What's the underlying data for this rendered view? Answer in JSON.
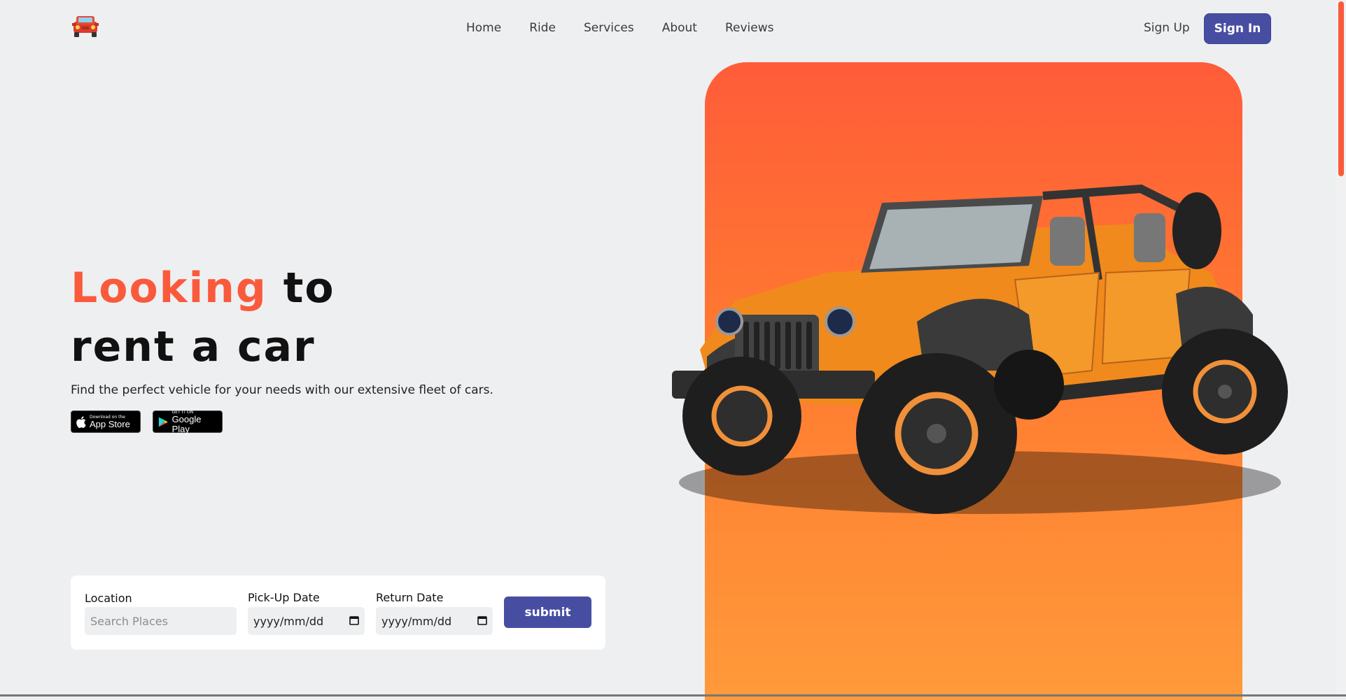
{
  "nav": {
    "logo_icon": "red-car-icon",
    "links": [
      "Home",
      "Ride",
      "Services",
      "About",
      "Reviews"
    ],
    "signup": "Sign Up",
    "signin": "Sign In"
  },
  "hero": {
    "title_accent": "Looking",
    "title_rest1": " to",
    "title_line2": "rent a car",
    "subtitle": "Find the perfect vehicle for your needs with our extensive fleet of cars.",
    "appstore_small": "Download on the",
    "appstore_big": "App Store",
    "googleplay_small": "GET IT ON",
    "googleplay_big": "Google Play",
    "image": "orange-jeep-image"
  },
  "form": {
    "location_label": "Location",
    "location_placeholder": "Search Places",
    "pickup_label": "Pick-Up Date",
    "pickup_value": "yyyy/mm/dd",
    "return_label": "Return Date",
    "return_value": "yyyy/mm/dd",
    "submit": "submit"
  },
  "colors": {
    "accent": "#fa5a3c",
    "primary_button": "#474ea2",
    "hero_gradient_top": "#ff5c39",
    "hero_gradient_bottom": "#ff9a3a"
  }
}
